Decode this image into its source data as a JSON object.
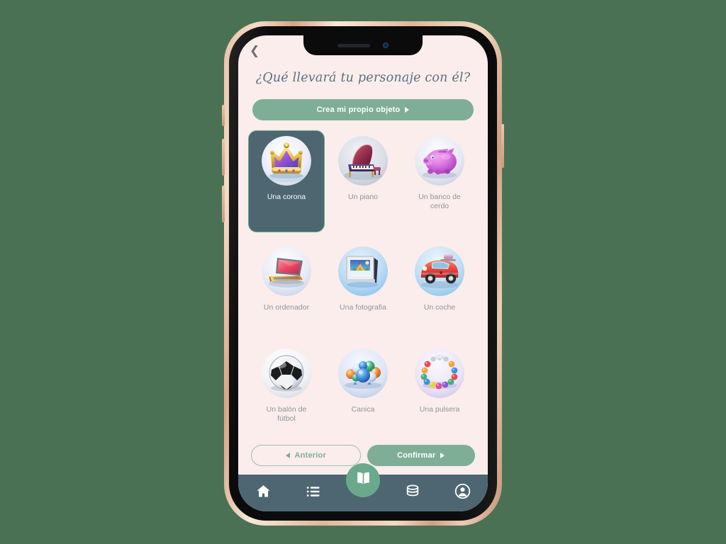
{
  "screen": {
    "back_icon": "back-chevron-icon",
    "title": "¿Qué llevará tu personaje con él?",
    "create_button": {
      "label": "Crea mi propio objeto",
      "arrow_icon": "triangle-right-icon"
    },
    "items": [
      {
        "label": "Una corona",
        "icon": "crown-icon",
        "selected": true
      },
      {
        "label": "Un piano",
        "icon": "piano-icon",
        "selected": false
      },
      {
        "label": "Un banco de cerdo",
        "icon": "piggy-bank-icon",
        "selected": false
      },
      {
        "label": "Un ordenador",
        "icon": "laptop-icon",
        "selected": false
      },
      {
        "label": "Una fotografia",
        "icon": "photo-frame-icon",
        "selected": false
      },
      {
        "label": "Un coche",
        "icon": "car-icon",
        "selected": false
      },
      {
        "label": "Un balón de fútbol",
        "icon": "soccer-ball-icon",
        "selected": false
      },
      {
        "label": "Canica",
        "icon": "marbles-icon",
        "selected": false
      },
      {
        "label": "Una pulsera",
        "icon": "bracelet-icon",
        "selected": false
      }
    ],
    "footer": {
      "previous_label": "Anterior",
      "previous_arrow_icon": "triangle-left-icon",
      "confirm_label": "Confirmar",
      "confirm_arrow_icon": "triangle-right-icon"
    },
    "navbar": {
      "items": [
        {
          "icon": "home-icon"
        },
        {
          "icon": "list-icon"
        },
        {
          "icon": "book-icon"
        },
        {
          "icon": "database-icon"
        },
        {
          "icon": "account-icon"
        }
      ]
    }
  },
  "colors": {
    "page_background": "#4a7153",
    "screen_background": "#faedec",
    "accent_green": "#7eaf96",
    "fab_green": "#6aa98c",
    "navbar_slate": "#4e6672",
    "selected_card": "#4d6670",
    "title_text": "#59707e",
    "label_text": "#90959a"
  }
}
